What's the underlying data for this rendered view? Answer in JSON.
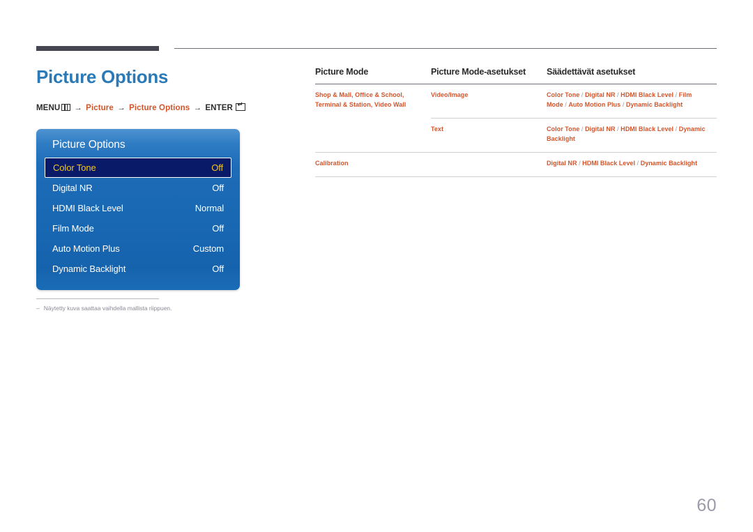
{
  "page": {
    "title": "Picture Options",
    "page_number": "60",
    "title_color": "#2b7ab8",
    "accent_color": "#d4542a",
    "rule_color": "#464652"
  },
  "breadcrumb": {
    "menu_label": "MENU",
    "menu_icon": "menu-grid-icon",
    "arrow": "→",
    "step1": "Picture",
    "step2": "Picture Options",
    "enter_label": "ENTER",
    "enter_icon": "enter-key-icon"
  },
  "osd": {
    "title": "Picture Options",
    "rows": [
      {
        "label": "Color Tone",
        "value": "Off",
        "selected": true
      },
      {
        "label": "Digital NR",
        "value": "Off",
        "selected": false
      },
      {
        "label": "HDMI Black Level",
        "value": "Normal",
        "selected": false
      },
      {
        "label": "Film Mode",
        "value": "Off",
        "selected": false
      },
      {
        "label": "Auto Motion Plus",
        "value": "Custom",
        "selected": false
      },
      {
        "label": "Dynamic Backlight",
        "value": "Off",
        "selected": false
      }
    ],
    "selected_bg": "#091a68",
    "selected_text": "#f5c518",
    "panel_blue": "#1868b4"
  },
  "footnote": {
    "dash": "–",
    "text": "Näytetty kuva saattaa vaihdella mallista riippuen."
  },
  "table": {
    "headers": [
      "Picture Mode",
      "Picture Mode-asetukset",
      "Säädettävät asetukset"
    ],
    "rows": [
      {
        "mode": "Shop & Mall, Office & School, Terminal & Station, Video Wall",
        "sub_rows": [
          {
            "setting": "Video/Image",
            "adjustable": "Color Tone / Digital NR / HDMI Black Level / Film Mode / Auto Motion Plus / Dynamic Backlight"
          },
          {
            "setting": "Text",
            "adjustable": "Color Tone / Digital NR / HDMI Black Level / Dynamic Backlight"
          }
        ]
      },
      {
        "mode": "Calibration",
        "sub_rows": [
          {
            "setting": "",
            "adjustable": "Digital NR / HDMI Black Level / Dynamic Backlight"
          }
        ]
      }
    ]
  }
}
